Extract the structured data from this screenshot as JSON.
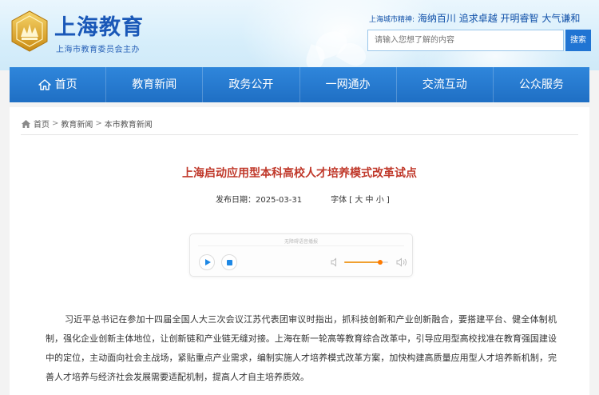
{
  "header": {
    "site_name": "上海教育",
    "site_sub": "上海市教育委员会主办",
    "slogan_lead": "上海城市精神:",
    "slogan_main": "海纳百川 追求卓越 开明睿智 大气谦和",
    "search": {
      "placeholder": "请输入您想了解的内容",
      "button_label": "搜索"
    }
  },
  "nav": {
    "items": [
      {
        "label": "首页",
        "icon": "home-icon"
      },
      {
        "label": "教育新闻"
      },
      {
        "label": "政务公开"
      },
      {
        "label": "一网通办"
      },
      {
        "label": "交流互动"
      },
      {
        "label": "公众服务"
      }
    ]
  },
  "breadcrumb": {
    "icon": "home-icon",
    "items": [
      "首页",
      "教育新闻",
      "本市教育新闻"
    ],
    "separator": ">"
  },
  "article": {
    "title": "上海启动应用型本科高校人才培养模式改革试点",
    "publish_label": "发布日期：",
    "publish_date": "2025-03-31",
    "font_label": "字体 [ 大 中 小 ]",
    "body": "习近平总书记在参加十四届全国人大三次会议江苏代表团审议时指出，抓科技创新和产业创新融合，要搭建平台、健全体制机制，强化企业创新主体地位，让创新链和产业链无缝对接。上海在新一轮高等教育综合改革中，引导应用型高校找准在教育强国建设中的定位，主动面向社会主战场，紧贴重点产业需求，编制实施人才培养模式改革方案，加快构建高质量应用型人才培养新机制，完善人才培养与经济社会发展需要适配机制，提高人才自主培养质效。"
  },
  "audio_player": {
    "status": "无障碍语音播报",
    "volume_fraction": 0.82,
    "accent_color": "#1e88e5",
    "volume_color": "#ff7a00"
  },
  "colors": {
    "brand_blue": "#1f6fc4",
    "title_red": "#c0392b",
    "search_button": "#2074d3"
  }
}
